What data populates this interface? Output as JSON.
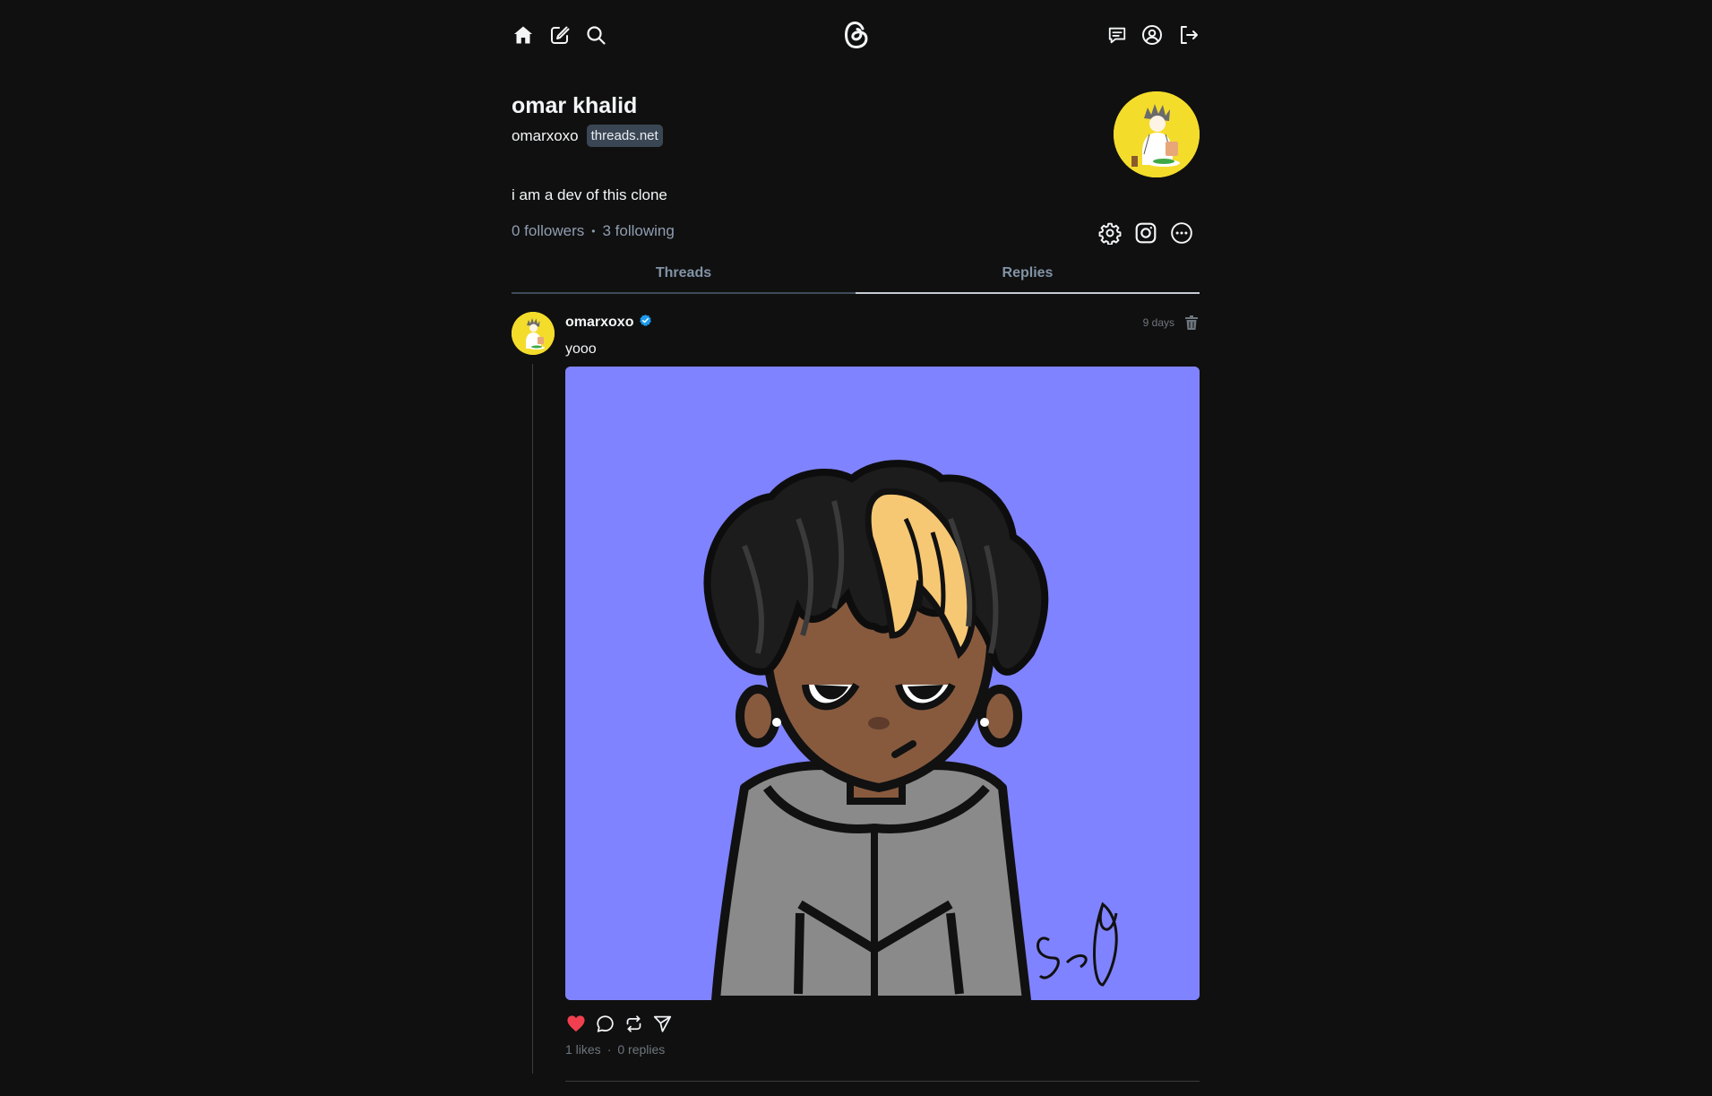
{
  "nav": {
    "left_icons": [
      "home-icon",
      "create-post-icon",
      "search-icon"
    ],
    "center_logo": "threads-logo",
    "right_icons": [
      "messages-icon",
      "profile-icon",
      "logout-icon"
    ]
  },
  "profile": {
    "name": "omar khalid",
    "username": "omarxoxo",
    "domain_badge": "threads.net",
    "bio": "i am a dev of this clone",
    "followers": "0 followers",
    "separator": "•",
    "following": "3 following",
    "avatar_bg": "#f4dc2b",
    "action_icons": [
      "settings-icon",
      "instagram-icon",
      "more-icon"
    ]
  },
  "tabs": [
    {
      "label": "Threads",
      "active": false
    },
    {
      "label": "Replies",
      "active": true
    }
  ],
  "post": {
    "username": "omarxoxo",
    "verified": true,
    "time": "9 days",
    "text": "yooo",
    "image_bg": "#8083ff",
    "liked": true,
    "likes": "1 likes",
    "separator": "·",
    "replies": "0 replies"
  },
  "colors": {
    "background": "#101010",
    "text": "#f3f5f7",
    "muted": "#8f9db0",
    "like": "#f0404f",
    "verified": "#1d9bf0"
  }
}
